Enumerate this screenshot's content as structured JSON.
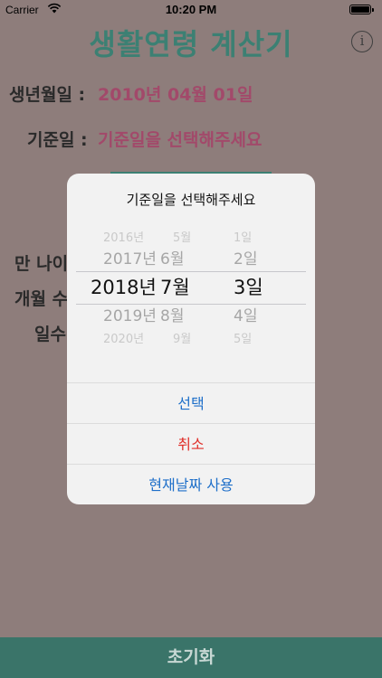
{
  "status_bar": {
    "carrier": "Carrier",
    "time": "10:20 PM"
  },
  "header": {
    "title": "생활연령 계산기",
    "info_glyph": "i"
  },
  "form": {
    "birth_label": "생년월일 :",
    "birth_value": "2010년 04월 01일",
    "ref_label": "기준일 :",
    "ref_value": "기준일을 선택해주세요",
    "age_label": "만 나이",
    "months_label": "개월 수",
    "days_label": "일수"
  },
  "modal": {
    "title": "기준일을 선택해주세요",
    "picker": {
      "years": [
        "2016년",
        "2017년",
        "2018년",
        "2019년",
        "2020년"
      ],
      "months": [
        "5월",
        "6월",
        "7월",
        "8월",
        "9월"
      ],
      "days": [
        "1일",
        "2일",
        "3일",
        "4일",
        "5일"
      ],
      "selected_index": 2
    },
    "select_label": "선택",
    "cancel_label": "취소",
    "today_label": "현재날짜 사용"
  },
  "footer": {
    "reset_label": "초기화"
  },
  "colors": {
    "accent": "#3c8073",
    "value": "#a2496a",
    "link": "#1e6fc9",
    "danger": "#e0302a"
  }
}
